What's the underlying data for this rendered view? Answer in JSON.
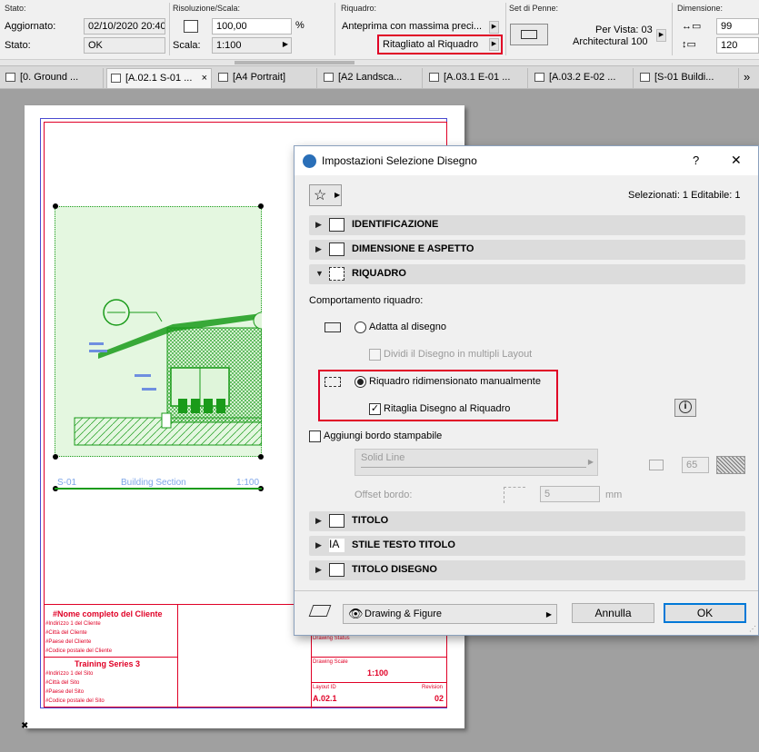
{
  "infobar": {
    "stato_section": "Stato:",
    "aggiornato_label": "Aggiornato:",
    "aggiornato_value": "02/10/2020 20:40",
    "stato_label": "Stato:",
    "stato_value": "OK",
    "risoluzione_section": "Risoluzione/Scala:",
    "risoluzione_value": "100,00",
    "percent": "%",
    "scala_label": "Scala:",
    "scala_value": "1:100",
    "riquadro_section": "Riquadro:",
    "anteprima_value": "Anteprima con massima preci...",
    "ritagliato_value": "Ritagliato al Riquadro",
    "set_penne_section": "Set di Penne:",
    "per_vista": "Per Vista: 03",
    "architectural": "Architectural 100",
    "dimensione_section": "Dimensione:",
    "dim_width": "99",
    "dim_height": "120"
  },
  "tabs": [
    {
      "label": "[0. Ground ..."
    },
    {
      "label": "[A.02.1 S-01 ...",
      "active": true,
      "close": "×"
    },
    {
      "label": "[A4 Portrait]"
    },
    {
      "label": "[A2 Landsca..."
    },
    {
      "label": "[A.03.1 E-01 ..."
    },
    {
      "label": "[A.03.2 E-02 ..."
    },
    {
      "label": "[S-01 Buildi..."
    }
  ],
  "tabs_more": "»",
  "drawing": {
    "id": "S-01",
    "name": "Building Section",
    "scale": "1:100"
  },
  "titleblock": {
    "client_name": "#Nome completo del Cliente",
    "client_lines": [
      "#Indirizzo 1 del Cliente",
      "#Città del Cliente",
      "#Paese del Cliente",
      "#Codice postale del Cliente"
    ],
    "project": "Training Series 3",
    "site_lines": [
      "#Indirizzo 1 del Sito",
      "#Città del Sito",
      "#Paese del Sito",
      "#Codice postale del Sito"
    ],
    "drawing_status": "Drawing Status",
    "drawing_scale_label": "Drawing Scale",
    "drawing_scale": "1:100",
    "layout_id_label": "Layout ID",
    "layout_id": "A.02.1",
    "revision_label": "Revision",
    "revision": "02"
  },
  "dialog": {
    "title": "Impostazioni Selezione Disegno",
    "help": "?",
    "close": "✕",
    "selection_info": "Selezionati: 1 Editabile: 1",
    "sections": {
      "identificazione": "IDENTIFICAZIONE",
      "dimensione": "DIMENSIONE E ASPETTO",
      "riquadro": "RIQUADRO",
      "titolo": "TITOLO",
      "stile": "STILE TESTO TITOLO",
      "titolo_disegno": "TITOLO DISEGNO"
    },
    "comportamento_label": "Comportamento riquadro:",
    "adatta_label": "Adatta al disegno",
    "dividi_label": "Dividi il Disegno in multipli Layout",
    "riquadro_manual_label": "Riquadro ridimensionato manualmente",
    "ritaglia_label": "Ritaglia Disegno al Riquadro",
    "aggiungi_bordo_label": "Aggiungi bordo stampabile",
    "line_type_value": "Solid Line",
    "pen_value": "65",
    "offset_label": "Offset bordo:",
    "offset_value": "5",
    "offset_unit": "mm",
    "favorites_value": "Drawing & Figure",
    "cancel_label": "Annulla",
    "ok_label": "OK"
  },
  "colors": {
    "highlight_red": "#e00026",
    "drawing_green": "#1a9b1a",
    "accent_blue": "#0078d7"
  }
}
